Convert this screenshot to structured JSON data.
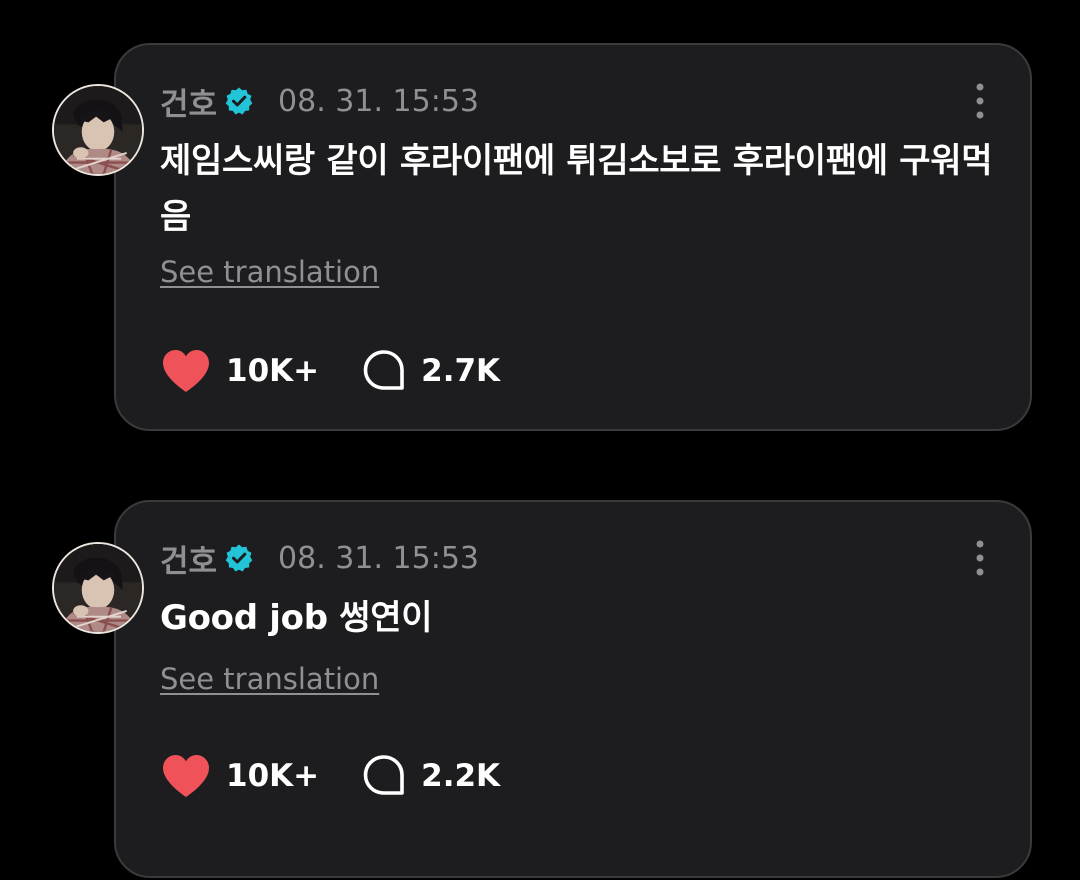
{
  "colors": {
    "background": "#000000",
    "card": "#1d1d1f",
    "card_border": "#3a3a3d",
    "muted_text": "#8f8f94",
    "like": "#f0525a",
    "verified_badge": "#22c4d8"
  },
  "posts": [
    {
      "author": "건호",
      "verified_icon": "verified-badge-icon",
      "timestamp": "08. 31. 15:53",
      "text": "제임스씨랑 같이 후라이팬에 튀김소보로 후라이팬에 구워먹음",
      "translate_label": "See translation",
      "likes": "10K+",
      "comments": "2.7K",
      "like_icon": "heart-icon",
      "comment_icon": "comment-bubble-icon",
      "more_icon": "more-vertical-icon"
    },
    {
      "author": "건호",
      "verified_icon": "verified-badge-icon",
      "timestamp": "08. 31. 15:53",
      "text": "Good job 썽연이",
      "translate_label": "See translation",
      "likes": "10K+",
      "comments": "2.2K",
      "like_icon": "heart-icon",
      "comment_icon": "comment-bubble-icon",
      "more_icon": "more-vertical-icon"
    }
  ]
}
